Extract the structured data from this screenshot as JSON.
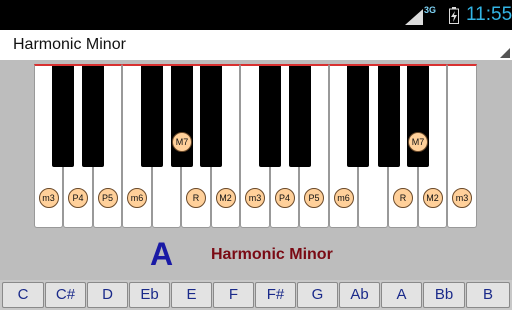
{
  "status": {
    "network": "3G",
    "time": "11:55"
  },
  "spinner": {
    "selected": "Harmonic Minor"
  },
  "scale": {
    "root": "A",
    "name": "Harmonic Minor"
  },
  "keyboard": {
    "white_markers": [
      "m3",
      "P4",
      "P5",
      "m6",
      "",
      "R",
      "M2",
      "m3",
      "P4",
      "P5",
      "m6",
      "",
      "R",
      "M2",
      "m3"
    ],
    "black_markers": [
      "",
      "",
      "",
      "M7",
      "",
      "",
      "",
      "",
      "",
      "M7"
    ]
  },
  "notes": [
    "C",
    "C#",
    "D",
    "Eb",
    "E",
    "F",
    "F#",
    "G",
    "Ab",
    "A",
    "Bb",
    "B"
  ],
  "colors": {
    "root_text": "#1a1aa5",
    "scale_text": "#7a0a14",
    "marker_fill": "#ffd09a",
    "note_text": "#1a2a8a",
    "time": "#33b5e5"
  }
}
